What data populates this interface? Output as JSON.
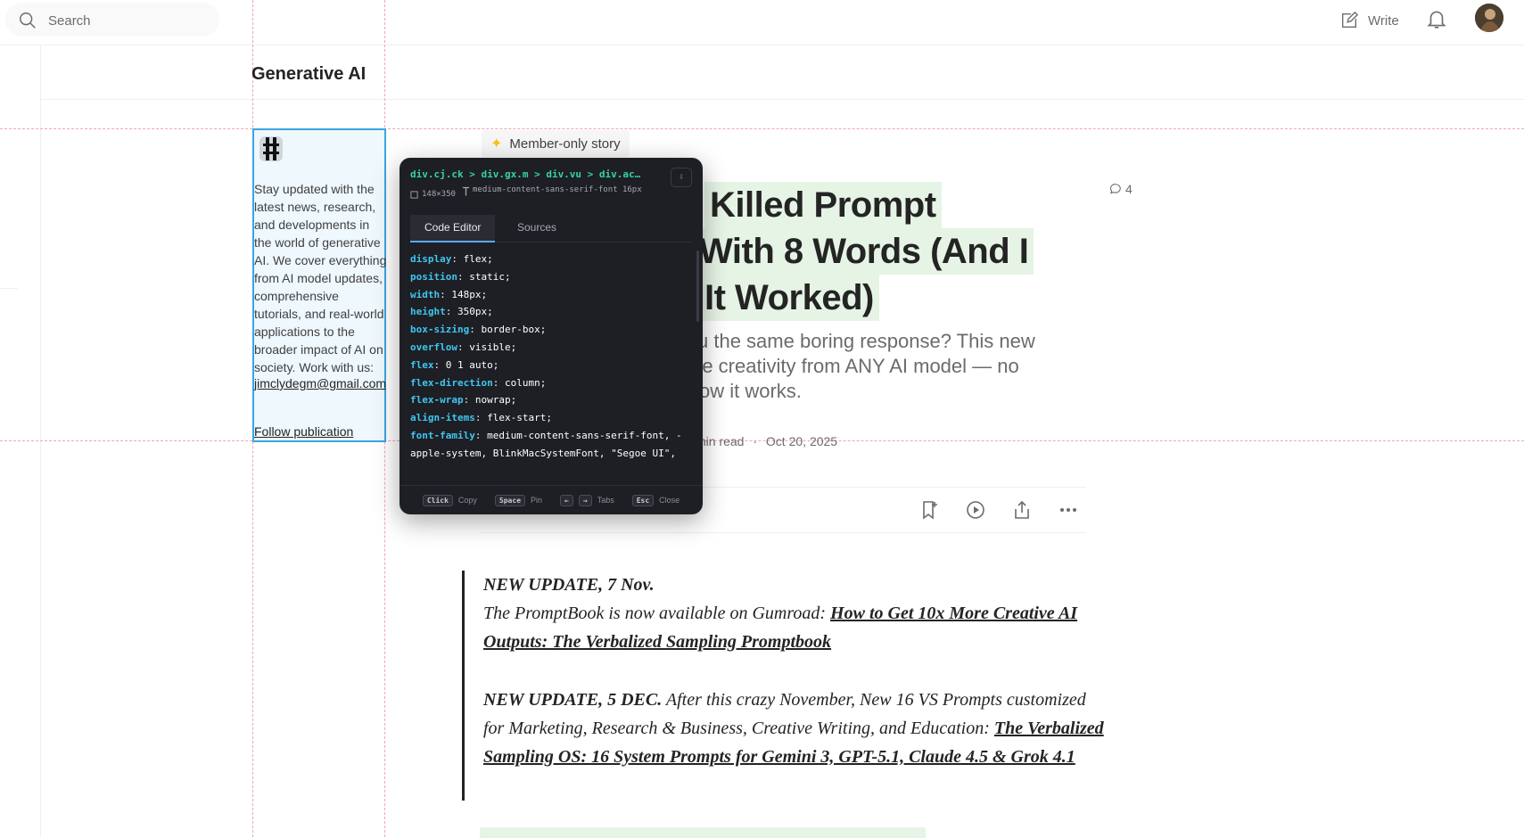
{
  "header": {
    "search_placeholder": "Search",
    "write_label": "Write"
  },
  "publication": {
    "name": "Generative AI",
    "description": "Stay updated with the latest news, research, and developments in the world of generative AI. We cover everything from AI model updates, comprehensive tutorials, and real-world applications to the broader impact of AI on society. Work with us:",
    "email": "jimclydegm@gmail.com",
    "follow_label": "Follow publication"
  },
  "article": {
    "badge": "Member-only story",
    "title_lines": [
      "Killed Prompt",
      "With 8 Words (And I",
      "It Worked)"
    ],
    "subtitle_lines": [
      "u the same boring response? This new",
      "re creativity from ANY AI model — no",
      "ow it works."
    ],
    "read_time": "min read",
    "date": "Oct 20, 2025",
    "comment_count": "4"
  },
  "quote": {
    "update1_head": "NEW UPDATE, 7 Nov.",
    "update1_text": "The PromptBook is now available on Gumroad: ",
    "update1_link": "How to Get 10x More Creative AI Outputs: The Verbalized Sampling Promptbook",
    "update2_head": "NEW UPDATE, 5 DEC.",
    "update2_text": " After this crazy November, New 16 VS Prompts customized for Marketing, Research & Business, Creative Writing, and Education: ",
    "update2_link": "The Verbalized Sampling OS: 16 System Prompts for Gemini 3, GPT-5.1, Claude 4.5 & Grok 4.1"
  },
  "devtools": {
    "selector": "div.cj.ck > div.gx.m > div.vu > div.ac…",
    "size": "148×350",
    "font": "medium-content-sans-serif-font 16px",
    "tabs": [
      "Code Editor",
      "Sources"
    ],
    "css": [
      {
        "prop": "display",
        "val": "flex;"
      },
      {
        "prop": "position",
        "val": "static;"
      },
      {
        "prop": "width",
        "val": "148px;"
      },
      {
        "prop": "height",
        "val": "350px;"
      },
      {
        "prop": "box-sizing",
        "val": "border-box;"
      },
      {
        "prop": "overflow",
        "val": "visible;"
      },
      {
        "prop": "flex",
        "val": "0 1 auto;"
      },
      {
        "prop": "flex-direction",
        "val": "column;"
      },
      {
        "prop": "flex-wrap",
        "val": "nowrap;"
      },
      {
        "prop": "align-items",
        "val": "flex-start;"
      },
      {
        "prop": "font-family",
        "val": "medium-content-sans-serif-font, -apple-system, BlinkMacSystemFont, \"Segoe UI\", Roboto, Oxygen, Ubuntu, Cantarell, \"Open Sans\","
      }
    ],
    "footer": {
      "click_key": "Click",
      "click_label": "Copy",
      "space_key": "Space",
      "space_label": "Pin",
      "left_key": "←",
      "right_key": "→",
      "tabs_label": "Tabs",
      "esc_key": "Esc",
      "esc_label": "Close"
    }
  },
  "colors": {
    "highlight_border": "#3aa6e0",
    "title_highlight": "#e6f4e6",
    "devtools_bg": "#1e1f24",
    "css_property": "#3fc6f0",
    "selector_green": "#34d3a4"
  }
}
